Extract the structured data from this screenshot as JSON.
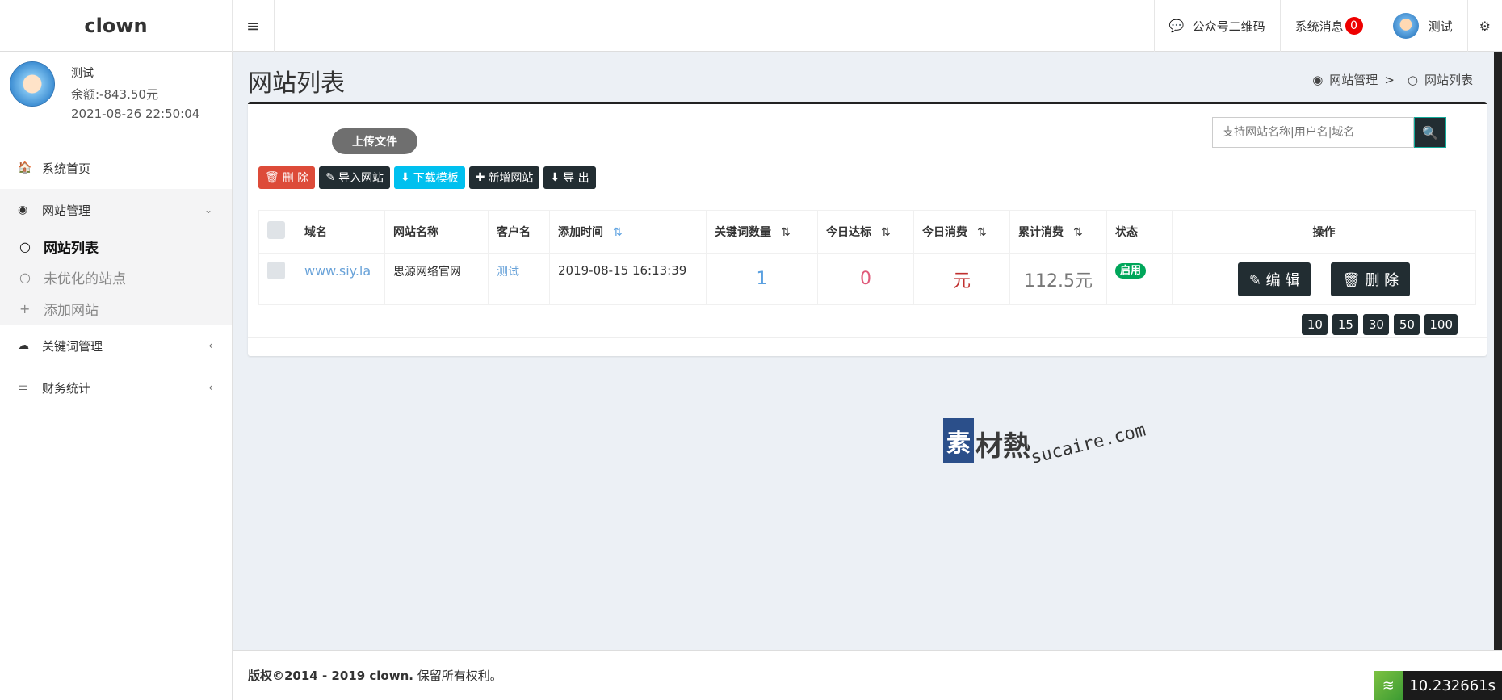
{
  "header": {
    "logo": "clown",
    "menu_toggle": "≡",
    "qrcode_label": "公众号二维码",
    "messages_label": "系统消息",
    "messages_count": "0",
    "user_name": "测试"
  },
  "sidebar": {
    "user": {
      "name": "测试",
      "balance": "余额:-843.50元",
      "time": "2021-08-26 22:50:04"
    },
    "items": [
      {
        "label": "系统首页"
      },
      {
        "label": "网站管理"
      },
      {
        "label": "关键词管理"
      },
      {
        "label": "财务统计"
      }
    ],
    "subitems": [
      {
        "label": "网站列表"
      },
      {
        "label": "未优化的站点"
      },
      {
        "label": "添加网站"
      }
    ]
  },
  "page": {
    "title": "网站列表",
    "breadcrumb": [
      "网站管理",
      ">",
      "网站列表"
    ]
  },
  "box": {
    "upload_label": "上传文件",
    "search_placeholder": "支持网站名称|用户名|域名",
    "toolbar": {
      "delete": "删 除",
      "import": "导入网站",
      "download": "下载模板",
      "add": "新增网站",
      "export": "导 出"
    }
  },
  "table": {
    "headers": [
      "域名",
      "网站名称",
      "客户名",
      "添加时间",
      "关键词数量",
      "今日达标",
      "今日消费",
      "累计消费",
      "状态",
      "操作"
    ],
    "rows": [
      {
        "domain": "www.siy.la",
        "site_name": "思源网络官网",
        "customer": "测试",
        "added": "2019-08-15 16:13:39",
        "keywords": "1",
        "today_ok": "0",
        "today_cost": "元",
        "total_cost": "112.5元",
        "status": "启用",
        "edit": "编 辑",
        "delete": "删 除"
      }
    ]
  },
  "pager": [
    "10",
    "15",
    "30",
    "50",
    "100"
  ],
  "watermark": {
    "square": "素",
    "cn": "材熱",
    "en": "sucaire.com"
  },
  "footer": {
    "copyright_bold": "版权©2014 - 2019 clown.",
    "copyright_rest": " 保留所有权利。"
  },
  "timer": "10.232661s",
  "colors": {
    "dark": "#222d32",
    "red": "#dd4b39",
    "cyan": "#00c0ef",
    "green": "#00a65a",
    "link": "#6aa3d9",
    "pink": "#e05a7a",
    "crimson": "#c0302f"
  }
}
